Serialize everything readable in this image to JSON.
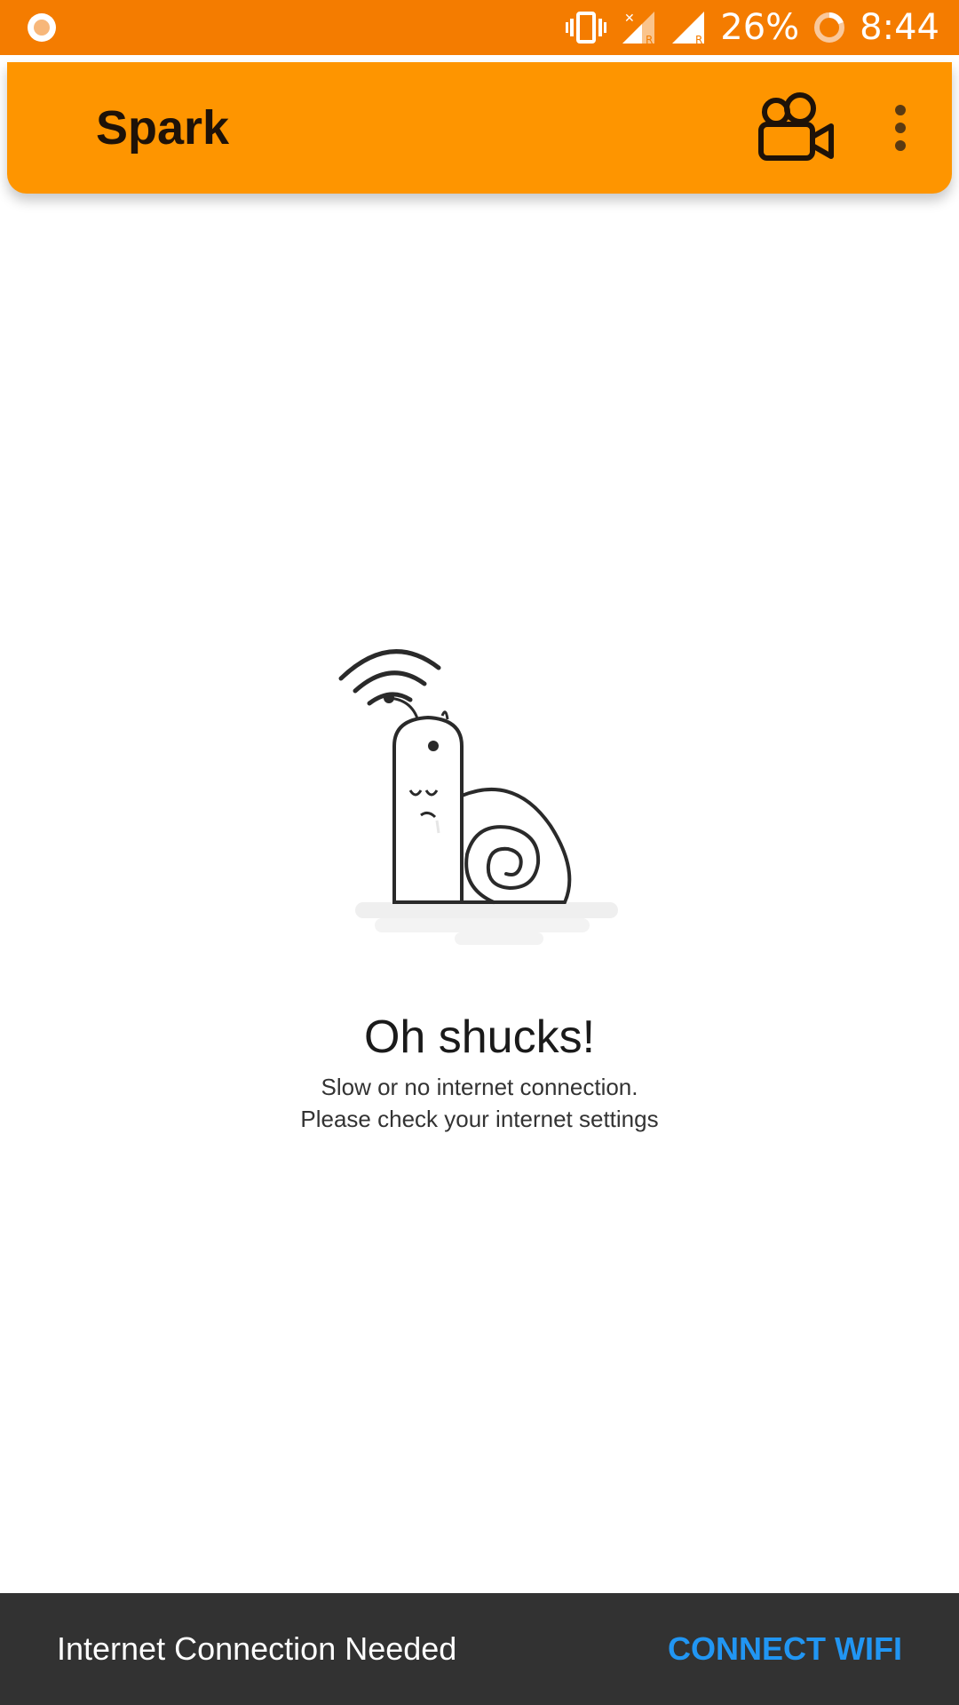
{
  "status_bar": {
    "battery_percent": "26%",
    "time": "8:44",
    "icons": [
      "app-notification-icon",
      "vibrate-icon",
      "signal-no-data-icon",
      "signal-icon",
      "battery-icon"
    ]
  },
  "app_bar": {
    "title": "Spark",
    "actions": [
      "camera-icon",
      "more-vert-icon"
    ]
  },
  "empty_state": {
    "illustration": "snail-wifi-illustration",
    "headline": "Oh shucks!",
    "line1": "Slow or no internet connection.",
    "line2": "Please check your internet settings"
  },
  "snackbar": {
    "message": "Internet Connection Needed",
    "action": "CONNECT WIFI"
  },
  "colors": {
    "status_bar": "#f47c00",
    "app_bar": "#fe9500",
    "snackbar_bg": "#323232",
    "snackbar_action": "#2196f3"
  }
}
